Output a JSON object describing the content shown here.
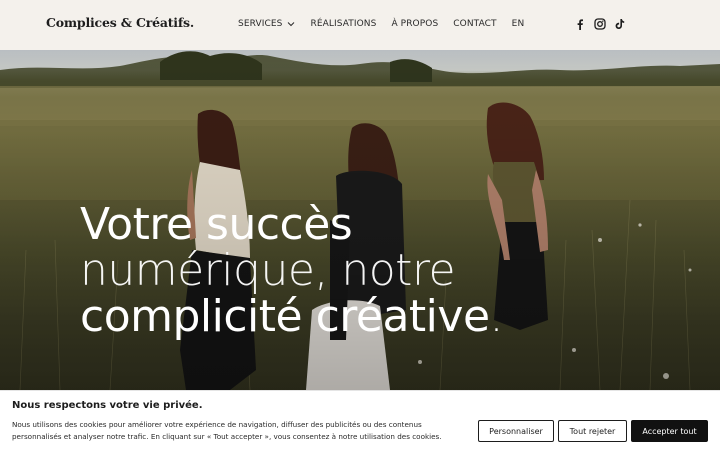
{
  "header": {
    "logo": "Complices & Créatifs.",
    "nav": [
      {
        "label": "SERVICES",
        "has_dropdown": true
      },
      {
        "label": "RÉALISATIONS"
      },
      {
        "label": "À PROPOS"
      },
      {
        "label": "CONTACT"
      },
      {
        "label": "EN"
      }
    ],
    "socials": [
      "facebook-icon",
      "instagram-icon",
      "tiktok-icon"
    ]
  },
  "hero": {
    "line1": "Votre succès",
    "line2": "numérique, notre",
    "line3": "complicité créative",
    "period": "."
  },
  "cookie": {
    "title": "Nous respectons votre vie privée.",
    "text": "Nous utilisons des cookies pour améliorer votre expérience de navigation, diffuser des publicités ou des contenus personnalisés et analyser notre trafic. En cliquant sur « Tout accepter », vous consentez à notre utilisation des cookies.",
    "customize_label": "Personnaliser",
    "reject_label": "Tout rejeter",
    "accept_label": "Accepter tout"
  },
  "colors": {
    "background": "#f4f1ec",
    "text": "#1d1d1d",
    "button_dark": "#111111"
  }
}
